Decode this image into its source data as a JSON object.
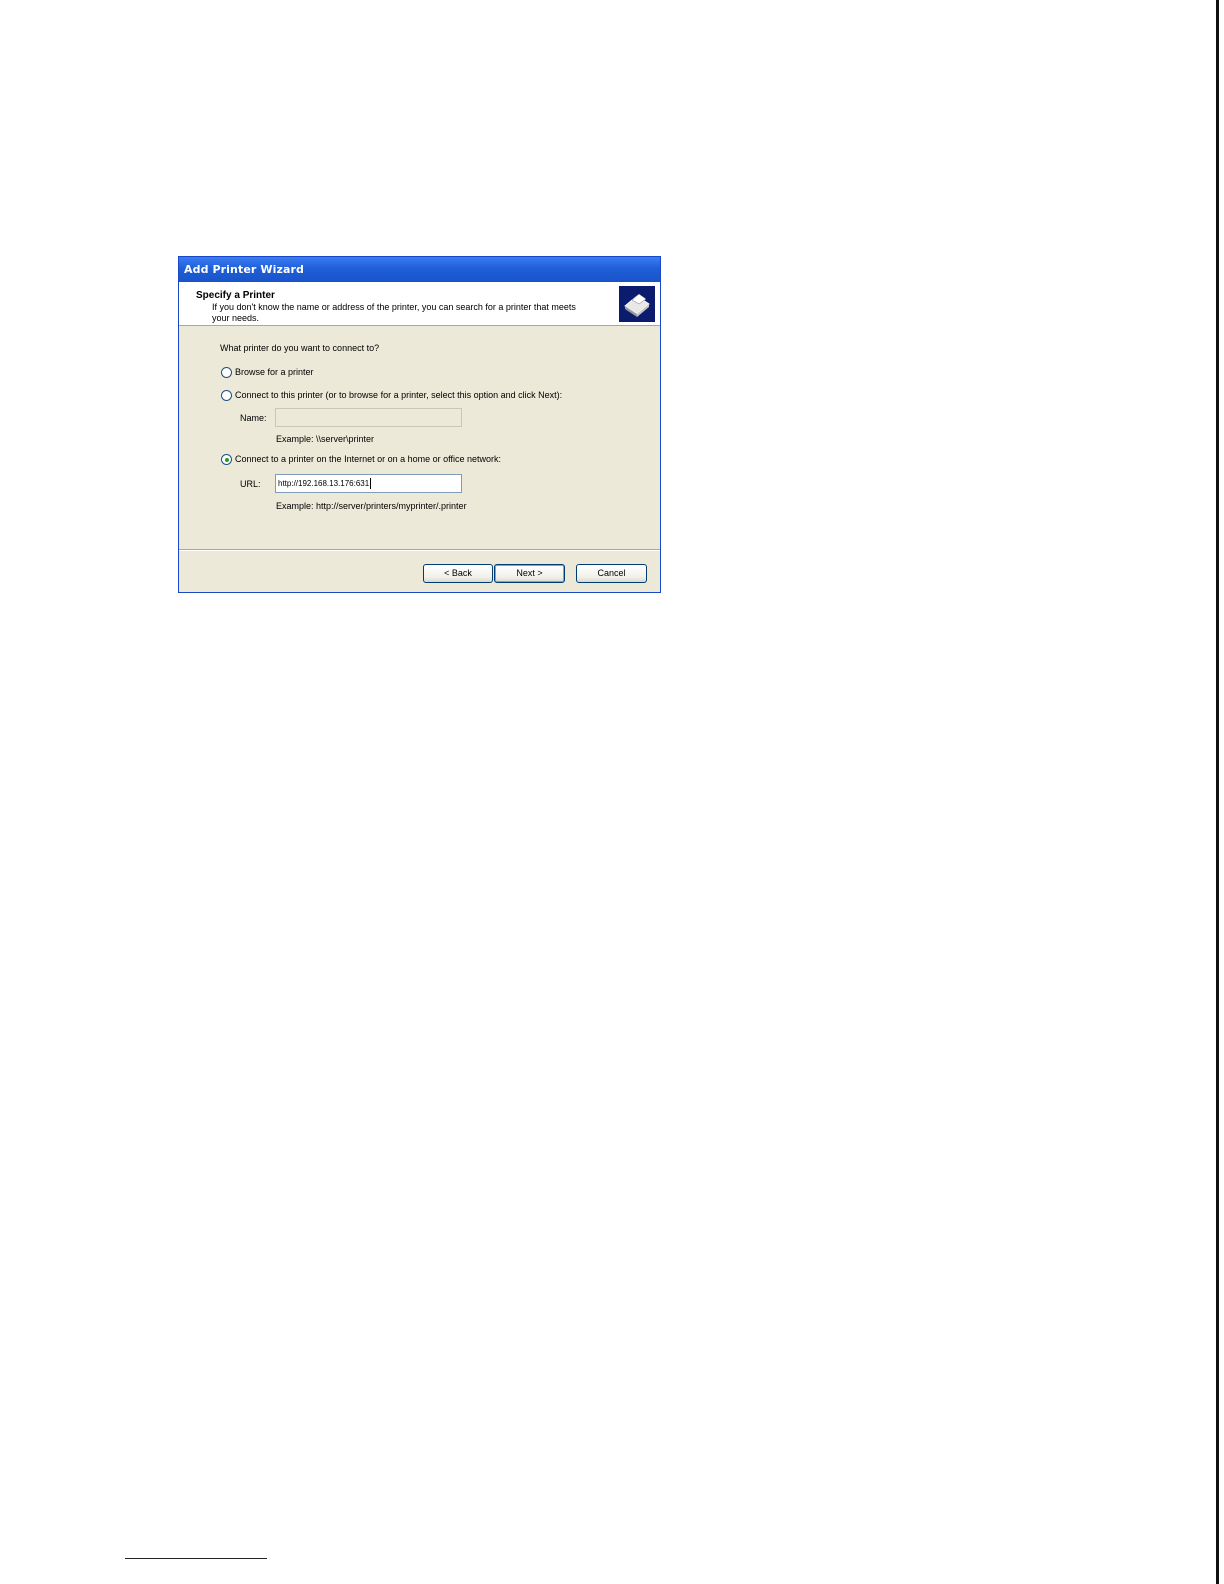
{
  "window": {
    "title": "Add Printer Wizard"
  },
  "header": {
    "title": "Specify a Printer",
    "description": "If you don't know the name or address of the printer, you can search for a printer that meets your needs.",
    "icon": "printer-icon"
  },
  "body": {
    "question": "What printer do you want to connect to?",
    "options": [
      {
        "label": "Browse for a printer",
        "selected": false
      },
      {
        "label": "Connect to this printer (or to browse for a printer, select this option and click Next):",
        "selected": false
      },
      {
        "label": "Connect to a printer on the Internet or on a home or office network:",
        "selected": true
      }
    ],
    "name_field": {
      "label": "Name:",
      "value": "",
      "example": "Example: \\\\server\\printer"
    },
    "url_field": {
      "label": "URL:",
      "value": "http://192.168.13.176:631",
      "example": "Example: http://server/printers/myprinter/.printer"
    }
  },
  "buttons": {
    "back": "< Back",
    "next": "Next >",
    "cancel": "Cancel"
  },
  "colors": {
    "title_bar": "#1f5fd8",
    "dialog_bg": "#ece9d8",
    "selected_radio": "#21a121"
  }
}
